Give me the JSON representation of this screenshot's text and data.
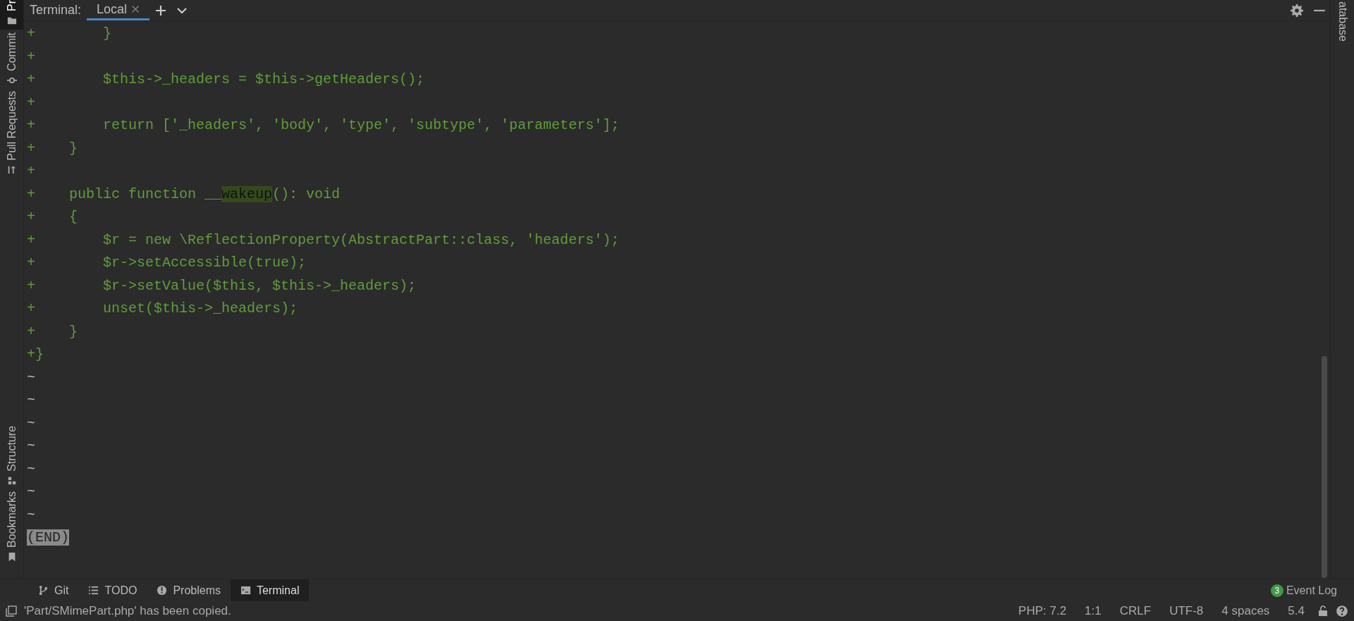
{
  "left_strip": {
    "items": [
      {
        "label": "Pr",
        "selected": true
      },
      {
        "label": "Commit",
        "selected": false
      },
      {
        "label": "Pull Requests",
        "selected": false
      },
      {
        "label": "Structure",
        "selected": false
      },
      {
        "label": "Bookmarks",
        "selected": false
      }
    ]
  },
  "right_strip": {
    "items": [
      {
        "label": "atabase"
      }
    ]
  },
  "terminal": {
    "title": "Terminal:",
    "tabs": [
      {
        "label": "Local",
        "selected": true,
        "closable": true
      }
    ],
    "lines": [
      {
        "kind": "code",
        "text": "+        }"
      },
      {
        "kind": "code",
        "text": "+"
      },
      {
        "kind": "code",
        "text": "+        $this->_headers = $this->getHeaders();"
      },
      {
        "kind": "code",
        "text": "+"
      },
      {
        "kind": "code",
        "text": "+        return ['_headers', 'body', 'type', 'subtype', 'parameters'];"
      },
      {
        "kind": "code",
        "text": "+    }"
      },
      {
        "kind": "code",
        "text": "+"
      },
      {
        "kind": "match",
        "parts": [
          "+    public function __",
          "wakeup",
          "(): void"
        ]
      },
      {
        "kind": "code",
        "text": "+    {"
      },
      {
        "kind": "code",
        "text": "+        $r = new \\ReflectionProperty(AbstractPart::class, 'headers');"
      },
      {
        "kind": "code",
        "text": "+        $r->setAccessible(true);"
      },
      {
        "kind": "code",
        "text": "+        $r->setValue($this, $this->_headers);"
      },
      {
        "kind": "code",
        "text": "+        unset($this->_headers);"
      },
      {
        "kind": "code",
        "text": "+    }"
      },
      {
        "kind": "code",
        "text": "+}"
      },
      {
        "kind": "filler",
        "text": "~"
      },
      {
        "kind": "filler",
        "text": "~"
      },
      {
        "kind": "filler",
        "text": "~"
      },
      {
        "kind": "filler",
        "text": "~"
      },
      {
        "kind": "filler",
        "text": "~"
      },
      {
        "kind": "filler",
        "text": "~"
      },
      {
        "kind": "filler",
        "text": "~"
      },
      {
        "kind": "prompt",
        "text": "(END)"
      }
    ]
  },
  "tool_windows": [
    {
      "label": "Git",
      "selected": false
    },
    {
      "label": "TODO",
      "selected": false
    },
    {
      "label": "Problems",
      "selected": false
    },
    {
      "label": "Terminal",
      "selected": true
    }
  ],
  "event_log": {
    "label": "Event Log",
    "count": "3"
  },
  "status_bar": {
    "message": "'Part/SMimePart.php' has been copied.",
    "items": [
      "PHP: 7.2",
      "1:1",
      "CRLF",
      "UTF-8",
      "4 spaces"
    ],
    "php_version": "5.4"
  }
}
